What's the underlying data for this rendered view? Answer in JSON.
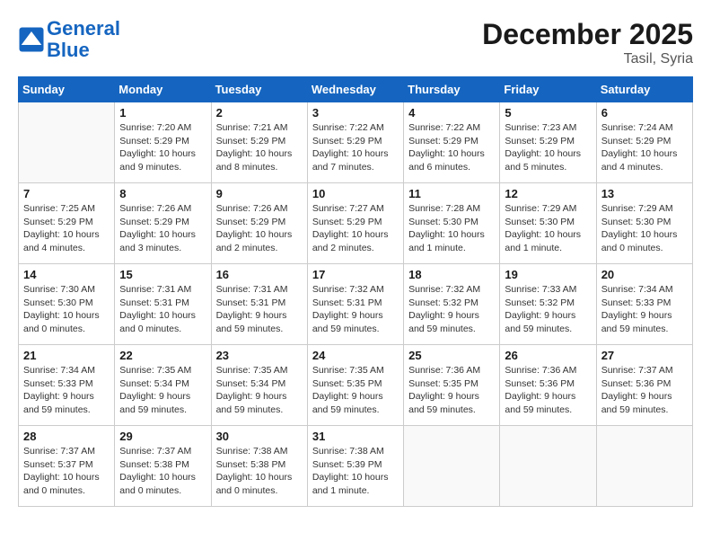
{
  "header": {
    "logo_line1": "General",
    "logo_line2": "Blue",
    "month_year": "December 2025",
    "location": "Tasil, Syria"
  },
  "columns": [
    "Sunday",
    "Monday",
    "Tuesday",
    "Wednesday",
    "Thursday",
    "Friday",
    "Saturday"
  ],
  "weeks": [
    [
      {
        "day": "",
        "info": ""
      },
      {
        "day": "1",
        "info": "Sunrise: 7:20 AM\nSunset: 5:29 PM\nDaylight: 10 hours\nand 9 minutes."
      },
      {
        "day": "2",
        "info": "Sunrise: 7:21 AM\nSunset: 5:29 PM\nDaylight: 10 hours\nand 8 minutes."
      },
      {
        "day": "3",
        "info": "Sunrise: 7:22 AM\nSunset: 5:29 PM\nDaylight: 10 hours\nand 7 minutes."
      },
      {
        "day": "4",
        "info": "Sunrise: 7:22 AM\nSunset: 5:29 PM\nDaylight: 10 hours\nand 6 minutes."
      },
      {
        "day": "5",
        "info": "Sunrise: 7:23 AM\nSunset: 5:29 PM\nDaylight: 10 hours\nand 5 minutes."
      },
      {
        "day": "6",
        "info": "Sunrise: 7:24 AM\nSunset: 5:29 PM\nDaylight: 10 hours\nand 4 minutes."
      }
    ],
    [
      {
        "day": "7",
        "info": "Sunrise: 7:25 AM\nSunset: 5:29 PM\nDaylight: 10 hours\nand 4 minutes."
      },
      {
        "day": "8",
        "info": "Sunrise: 7:26 AM\nSunset: 5:29 PM\nDaylight: 10 hours\nand 3 minutes."
      },
      {
        "day": "9",
        "info": "Sunrise: 7:26 AM\nSunset: 5:29 PM\nDaylight: 10 hours\nand 2 minutes."
      },
      {
        "day": "10",
        "info": "Sunrise: 7:27 AM\nSunset: 5:29 PM\nDaylight: 10 hours\nand 2 minutes."
      },
      {
        "day": "11",
        "info": "Sunrise: 7:28 AM\nSunset: 5:30 PM\nDaylight: 10 hours\nand 1 minute."
      },
      {
        "day": "12",
        "info": "Sunrise: 7:29 AM\nSunset: 5:30 PM\nDaylight: 10 hours\nand 1 minute."
      },
      {
        "day": "13",
        "info": "Sunrise: 7:29 AM\nSunset: 5:30 PM\nDaylight: 10 hours\nand 0 minutes."
      }
    ],
    [
      {
        "day": "14",
        "info": "Sunrise: 7:30 AM\nSunset: 5:30 PM\nDaylight: 10 hours\nand 0 minutes."
      },
      {
        "day": "15",
        "info": "Sunrise: 7:31 AM\nSunset: 5:31 PM\nDaylight: 10 hours\nand 0 minutes."
      },
      {
        "day": "16",
        "info": "Sunrise: 7:31 AM\nSunset: 5:31 PM\nDaylight: 9 hours\nand 59 minutes."
      },
      {
        "day": "17",
        "info": "Sunrise: 7:32 AM\nSunset: 5:31 PM\nDaylight: 9 hours\nand 59 minutes."
      },
      {
        "day": "18",
        "info": "Sunrise: 7:32 AM\nSunset: 5:32 PM\nDaylight: 9 hours\nand 59 minutes."
      },
      {
        "day": "19",
        "info": "Sunrise: 7:33 AM\nSunset: 5:32 PM\nDaylight: 9 hours\nand 59 minutes."
      },
      {
        "day": "20",
        "info": "Sunrise: 7:34 AM\nSunset: 5:33 PM\nDaylight: 9 hours\nand 59 minutes."
      }
    ],
    [
      {
        "day": "21",
        "info": "Sunrise: 7:34 AM\nSunset: 5:33 PM\nDaylight: 9 hours\nand 59 minutes."
      },
      {
        "day": "22",
        "info": "Sunrise: 7:35 AM\nSunset: 5:34 PM\nDaylight: 9 hours\nand 59 minutes."
      },
      {
        "day": "23",
        "info": "Sunrise: 7:35 AM\nSunset: 5:34 PM\nDaylight: 9 hours\nand 59 minutes."
      },
      {
        "day": "24",
        "info": "Sunrise: 7:35 AM\nSunset: 5:35 PM\nDaylight: 9 hours\nand 59 minutes."
      },
      {
        "day": "25",
        "info": "Sunrise: 7:36 AM\nSunset: 5:35 PM\nDaylight: 9 hours\nand 59 minutes."
      },
      {
        "day": "26",
        "info": "Sunrise: 7:36 AM\nSunset: 5:36 PM\nDaylight: 9 hours\nand 59 minutes."
      },
      {
        "day": "27",
        "info": "Sunrise: 7:37 AM\nSunset: 5:36 PM\nDaylight: 9 hours\nand 59 minutes."
      }
    ],
    [
      {
        "day": "28",
        "info": "Sunrise: 7:37 AM\nSunset: 5:37 PM\nDaylight: 10 hours\nand 0 minutes."
      },
      {
        "day": "29",
        "info": "Sunrise: 7:37 AM\nSunset: 5:38 PM\nDaylight: 10 hours\nand 0 minutes."
      },
      {
        "day": "30",
        "info": "Sunrise: 7:38 AM\nSunset: 5:38 PM\nDaylight: 10 hours\nand 0 minutes."
      },
      {
        "day": "31",
        "info": "Sunrise: 7:38 AM\nSunset: 5:39 PM\nDaylight: 10 hours\nand 1 minute."
      },
      {
        "day": "",
        "info": ""
      },
      {
        "day": "",
        "info": ""
      },
      {
        "day": "",
        "info": ""
      }
    ]
  ]
}
